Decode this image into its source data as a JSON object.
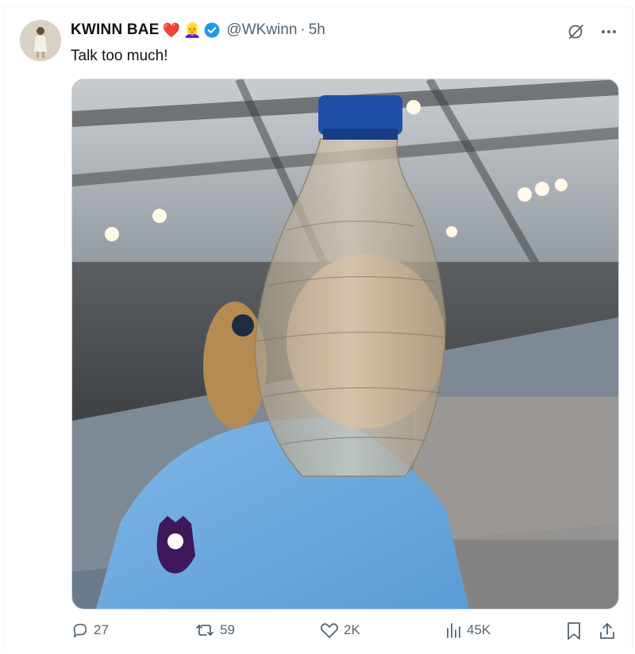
{
  "tweet": {
    "display_name": "KWINN BAE",
    "name_emojis": [
      "❤️",
      "👱‍♀️"
    ],
    "handle": "@WKwinn",
    "separator": "·",
    "timestamp": "5h",
    "text": "Talk too much!"
  },
  "icons": {
    "grok": "grok-icon",
    "more": "more-icon",
    "verified": "verified-badge-icon"
  },
  "actions": {
    "replies": "27",
    "reposts": "59",
    "likes": "2K",
    "views": "45K"
  },
  "colors": {
    "text": "#0f1419",
    "secondary": "#536471",
    "verified": "#1d9bf0",
    "border": "#cfd9de"
  }
}
